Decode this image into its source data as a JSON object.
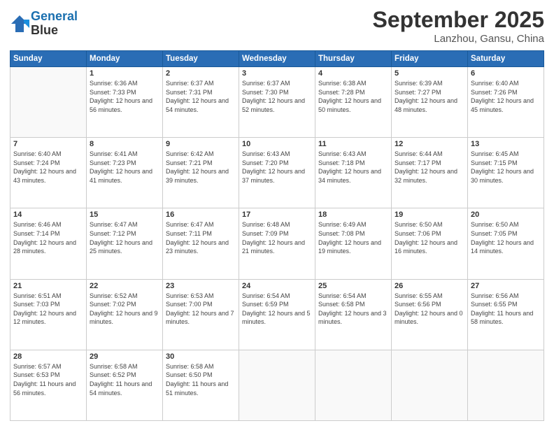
{
  "header": {
    "logo_line1": "General",
    "logo_line2": "Blue",
    "month": "September 2025",
    "location": "Lanzhou, Gansu, China"
  },
  "weekdays": [
    "Sunday",
    "Monday",
    "Tuesday",
    "Wednesday",
    "Thursday",
    "Friday",
    "Saturday"
  ],
  "weeks": [
    [
      {
        "day": "",
        "sunrise": "",
        "sunset": "",
        "daylight": ""
      },
      {
        "day": "1",
        "sunrise": "Sunrise: 6:36 AM",
        "sunset": "Sunset: 7:33 PM",
        "daylight": "Daylight: 12 hours and 56 minutes."
      },
      {
        "day": "2",
        "sunrise": "Sunrise: 6:37 AM",
        "sunset": "Sunset: 7:31 PM",
        "daylight": "Daylight: 12 hours and 54 minutes."
      },
      {
        "day": "3",
        "sunrise": "Sunrise: 6:37 AM",
        "sunset": "Sunset: 7:30 PM",
        "daylight": "Daylight: 12 hours and 52 minutes."
      },
      {
        "day": "4",
        "sunrise": "Sunrise: 6:38 AM",
        "sunset": "Sunset: 7:28 PM",
        "daylight": "Daylight: 12 hours and 50 minutes."
      },
      {
        "day": "5",
        "sunrise": "Sunrise: 6:39 AM",
        "sunset": "Sunset: 7:27 PM",
        "daylight": "Daylight: 12 hours and 48 minutes."
      },
      {
        "day": "6",
        "sunrise": "Sunrise: 6:40 AM",
        "sunset": "Sunset: 7:26 PM",
        "daylight": "Daylight: 12 hours and 45 minutes."
      }
    ],
    [
      {
        "day": "7",
        "sunrise": "Sunrise: 6:40 AM",
        "sunset": "Sunset: 7:24 PM",
        "daylight": "Daylight: 12 hours and 43 minutes."
      },
      {
        "day": "8",
        "sunrise": "Sunrise: 6:41 AM",
        "sunset": "Sunset: 7:23 PM",
        "daylight": "Daylight: 12 hours and 41 minutes."
      },
      {
        "day": "9",
        "sunrise": "Sunrise: 6:42 AM",
        "sunset": "Sunset: 7:21 PM",
        "daylight": "Daylight: 12 hours and 39 minutes."
      },
      {
        "day": "10",
        "sunrise": "Sunrise: 6:43 AM",
        "sunset": "Sunset: 7:20 PM",
        "daylight": "Daylight: 12 hours and 37 minutes."
      },
      {
        "day": "11",
        "sunrise": "Sunrise: 6:43 AM",
        "sunset": "Sunset: 7:18 PM",
        "daylight": "Daylight: 12 hours and 34 minutes."
      },
      {
        "day": "12",
        "sunrise": "Sunrise: 6:44 AM",
        "sunset": "Sunset: 7:17 PM",
        "daylight": "Daylight: 12 hours and 32 minutes."
      },
      {
        "day": "13",
        "sunrise": "Sunrise: 6:45 AM",
        "sunset": "Sunset: 7:15 PM",
        "daylight": "Daylight: 12 hours and 30 minutes."
      }
    ],
    [
      {
        "day": "14",
        "sunrise": "Sunrise: 6:46 AM",
        "sunset": "Sunset: 7:14 PM",
        "daylight": "Daylight: 12 hours and 28 minutes."
      },
      {
        "day": "15",
        "sunrise": "Sunrise: 6:47 AM",
        "sunset": "Sunset: 7:12 PM",
        "daylight": "Daylight: 12 hours and 25 minutes."
      },
      {
        "day": "16",
        "sunrise": "Sunrise: 6:47 AM",
        "sunset": "Sunset: 7:11 PM",
        "daylight": "Daylight: 12 hours and 23 minutes."
      },
      {
        "day": "17",
        "sunrise": "Sunrise: 6:48 AM",
        "sunset": "Sunset: 7:09 PM",
        "daylight": "Daylight: 12 hours and 21 minutes."
      },
      {
        "day": "18",
        "sunrise": "Sunrise: 6:49 AM",
        "sunset": "Sunset: 7:08 PM",
        "daylight": "Daylight: 12 hours and 19 minutes."
      },
      {
        "day": "19",
        "sunrise": "Sunrise: 6:50 AM",
        "sunset": "Sunset: 7:06 PM",
        "daylight": "Daylight: 12 hours and 16 minutes."
      },
      {
        "day": "20",
        "sunrise": "Sunrise: 6:50 AM",
        "sunset": "Sunset: 7:05 PM",
        "daylight": "Daylight: 12 hours and 14 minutes."
      }
    ],
    [
      {
        "day": "21",
        "sunrise": "Sunrise: 6:51 AM",
        "sunset": "Sunset: 7:03 PM",
        "daylight": "Daylight: 12 hours and 12 minutes."
      },
      {
        "day": "22",
        "sunrise": "Sunrise: 6:52 AM",
        "sunset": "Sunset: 7:02 PM",
        "daylight": "Daylight: 12 hours and 9 minutes."
      },
      {
        "day": "23",
        "sunrise": "Sunrise: 6:53 AM",
        "sunset": "Sunset: 7:00 PM",
        "daylight": "Daylight: 12 hours and 7 minutes."
      },
      {
        "day": "24",
        "sunrise": "Sunrise: 6:54 AM",
        "sunset": "Sunset: 6:59 PM",
        "daylight": "Daylight: 12 hours and 5 minutes."
      },
      {
        "day": "25",
        "sunrise": "Sunrise: 6:54 AM",
        "sunset": "Sunset: 6:58 PM",
        "daylight": "Daylight: 12 hours and 3 minutes."
      },
      {
        "day": "26",
        "sunrise": "Sunrise: 6:55 AM",
        "sunset": "Sunset: 6:56 PM",
        "daylight": "Daylight: 12 hours and 0 minutes."
      },
      {
        "day": "27",
        "sunrise": "Sunrise: 6:56 AM",
        "sunset": "Sunset: 6:55 PM",
        "daylight": "Daylight: 11 hours and 58 minutes."
      }
    ],
    [
      {
        "day": "28",
        "sunrise": "Sunrise: 6:57 AM",
        "sunset": "Sunset: 6:53 PM",
        "daylight": "Daylight: 11 hours and 56 minutes."
      },
      {
        "day": "29",
        "sunrise": "Sunrise: 6:58 AM",
        "sunset": "Sunset: 6:52 PM",
        "daylight": "Daylight: 11 hours and 54 minutes."
      },
      {
        "day": "30",
        "sunrise": "Sunrise: 6:58 AM",
        "sunset": "Sunset: 6:50 PM",
        "daylight": "Daylight: 11 hours and 51 minutes."
      },
      {
        "day": "",
        "sunrise": "",
        "sunset": "",
        "daylight": ""
      },
      {
        "day": "",
        "sunrise": "",
        "sunset": "",
        "daylight": ""
      },
      {
        "day": "",
        "sunrise": "",
        "sunset": "",
        "daylight": ""
      },
      {
        "day": "",
        "sunrise": "",
        "sunset": "",
        "daylight": ""
      }
    ]
  ]
}
